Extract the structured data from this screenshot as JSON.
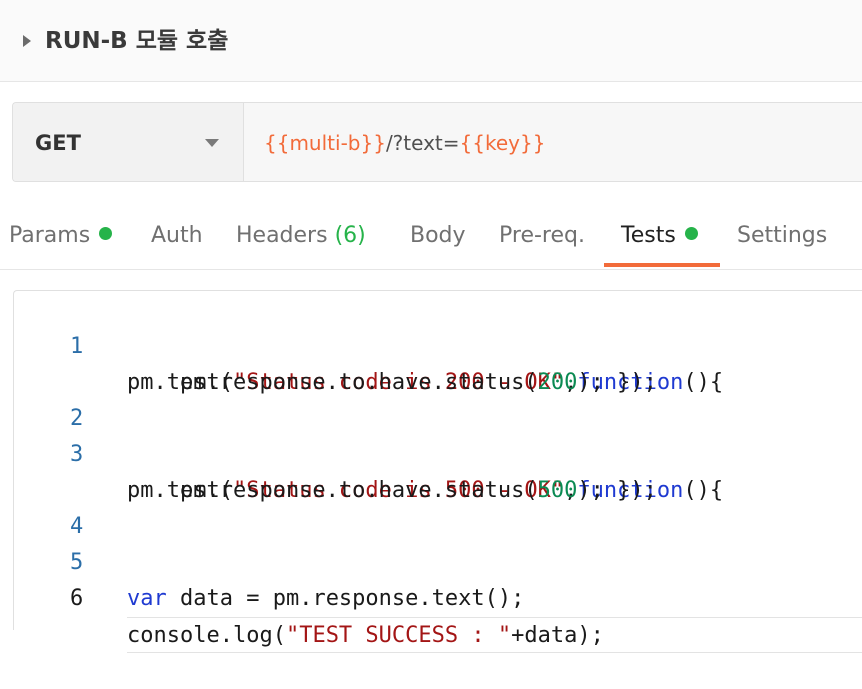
{
  "header": {
    "title": "RUN-B 모듈 호출"
  },
  "request": {
    "method": "GET",
    "url_var1": "{{multi-b}}",
    "url_mid": "/?text=",
    "url_var2": "{{key}}"
  },
  "tabs": [
    {
      "label": "Params",
      "dot": true
    },
    {
      "label": "Auth"
    },
    {
      "label": "Headers",
      "count": "(6)"
    },
    {
      "label": "Body"
    },
    {
      "label": "Pre-req."
    },
    {
      "label": "Tests",
      "dot": true,
      "active": true
    },
    {
      "label": "Settings"
    }
  ],
  "code": {
    "l1_num": "1",
    "l1_a": "pm.test(",
    "l1_str": "\"Status code is 200 - OK\"",
    "l1_b": ",",
    "l1_kw": "function",
    "l1_c": "(){",
    "l1b_a": "    pm.response.to.have.status(",
    "l1b_num": "200",
    "l1b_b": "); });",
    "l2_num": "2",
    "l3_num": "3",
    "l3_a": "pm.test(",
    "l3_str": "\"Status code is 500 - OK\"",
    "l3_b": ",",
    "l3_kw": "function",
    "l3_c": "(){",
    "l3b_a": "    pm.response.to.have.status(",
    "l3b_num": "500",
    "l3b_b": "); });",
    "l4_num": "4",
    "l5_num": "5",
    "l5_kw": "var",
    "l5_a": " data = pm.response.text();",
    "l6_num": "6",
    "l6_a": "console.log(",
    "l6_str": "\"TEST SUCCESS : \"",
    "l6_b": "+data);"
  },
  "colors": {
    "accent": "#f26b3a",
    "status_dot": "#26b34a",
    "keyword": "#1f3ad1",
    "string": "#a31515",
    "number": "#0b8a52",
    "line_number": "#2b6ea8"
  }
}
